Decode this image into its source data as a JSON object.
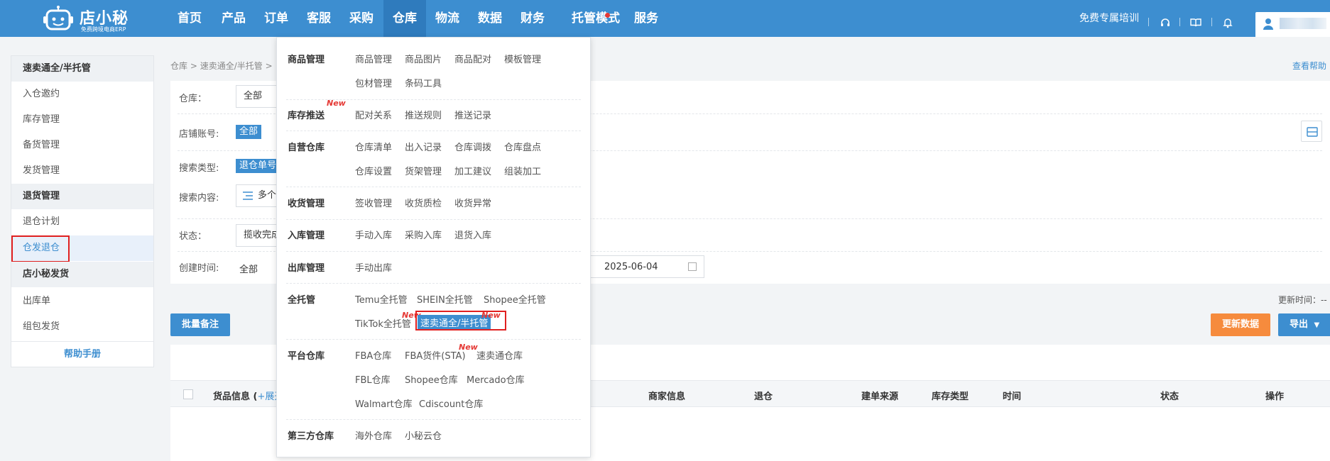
{
  "brand": {
    "name": "店小秘",
    "tagline": "免费跨境电商ERP"
  },
  "nav": {
    "items": [
      "首页",
      "产品",
      "订单",
      "客服",
      "采购",
      "仓库",
      "物流",
      "数据",
      "财务",
      "托管模式",
      "服务"
    ],
    "active_index": 5,
    "dot_index": 9
  },
  "top_right": {
    "training": "免费专属培训"
  },
  "sidebar": {
    "groups": [
      {
        "title": "速卖通全/半托管",
        "items": [
          "入仓邀约",
          "库存管理",
          "备货管理",
          "发货管理"
        ]
      },
      {
        "title": "退货管理",
        "items": [
          "退仓计划",
          "仓发退仓"
        ]
      },
      {
        "title": "店小秘发货",
        "items": [
          "出库单",
          "组包发货"
        ]
      }
    ],
    "active_item": "仓发退仓",
    "help": "帮助手册"
  },
  "breadcrumb": {
    "items": [
      "仓库",
      "速卖通全/半托管"
    ],
    "sep": ">",
    "trailing": ">"
  },
  "help_link": "查看帮助",
  "filter": {
    "warehouse_label": "仓库：",
    "warehouse_value": "全部",
    "store_label": "店铺账号:",
    "store_tag": "全部",
    "search_type_label": "搜索类型:",
    "search_type_tag": "退仓单号",
    "search_content_label": "搜索内容:",
    "search_content_value": "多个",
    "status_label": "状态：",
    "status_value": "揽收完成",
    "created_label": "创建时间:",
    "created_value": "全部",
    "date_end": "2025-06-04",
    "date_arrow": "→"
  },
  "toolbar": {
    "batch_note": "批量备注",
    "update_time_label": "更新时间：--",
    "refresh": "更新数据",
    "export": "导出"
  },
  "table": {
    "headers": {
      "goods": "货品信息 (",
      "expand": "+展开",
      "merchant": "商家信息",
      "return": "退仓",
      "source": "建单来源",
      "stock_type": "库存类型",
      "time": "时间",
      "status": "状态",
      "ops": "操作"
    }
  },
  "dropdown": {
    "new_label": "New",
    "categories": [
      {
        "title": "商品管理",
        "links": [
          "商品管理",
          "商品图片",
          "商品配对",
          "模板管理",
          "包材管理",
          "条码工具"
        ]
      },
      {
        "title": "库存推送",
        "links": [
          "配对关系",
          "推送规则",
          "推送记录"
        ]
      },
      {
        "title": "自营仓库",
        "links": [
          "仓库清单",
          "出入记录",
          "仓库调拨",
          "仓库盘点",
          "仓库设置",
          "货架管理",
          "加工建议",
          "组装加工"
        ]
      },
      {
        "title": "收货管理",
        "links": [
          "签收管理",
          "收货质检",
          "收货异常"
        ]
      },
      {
        "title": "入库管理",
        "links": [
          "手动入库",
          "采购入库",
          "退货入库"
        ]
      },
      {
        "title": "出库管理",
        "links": [
          "手动出库"
        ]
      },
      {
        "title": "全托管",
        "links": [
          "Temu全托管",
          "SHEIN全托管",
          "Shopee全托管",
          "TikTok全托管",
          "速卖通全/半托管"
        ]
      },
      {
        "title": "平台仓库",
        "links": [
          "FBA仓库",
          "FBA货件(STA)",
          "速卖通仓库",
          "FBL仓库",
          "Shopee仓库",
          "Mercado仓库",
          "Walmart仓库",
          "Cdiscount仓库"
        ]
      },
      {
        "title": "第三方仓库",
        "links": [
          "海外仓库",
          "小秘云仓"
        ]
      }
    ],
    "active_link": "速卖通全/半托管"
  },
  "colors": {
    "primary": "#3d8ed0",
    "accent": "#f68b3d",
    "highlight": "#e02020",
    "new": "#e53935"
  }
}
